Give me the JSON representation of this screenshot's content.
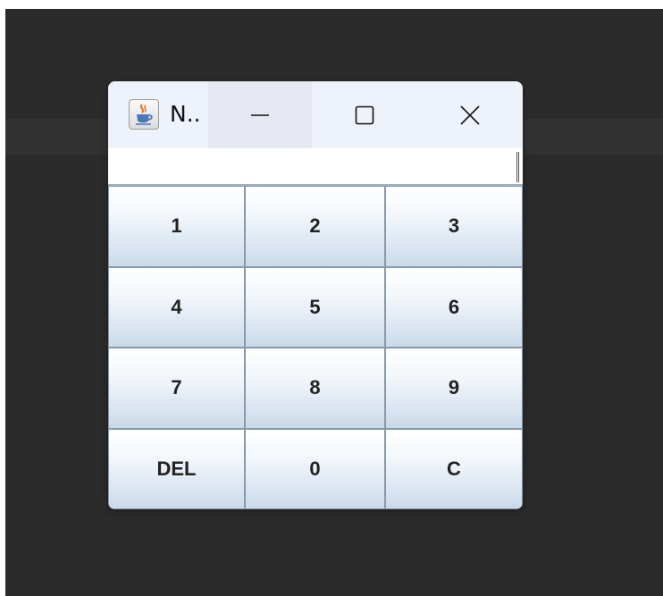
{
  "window": {
    "title": "N.."
  },
  "title_icon": "java-coffee-icon",
  "caption_buttons": {
    "minimize_icon": "minimize-icon",
    "maximize_icon": "maximize-icon",
    "close_icon": "close-icon"
  },
  "display": {
    "value": ""
  },
  "keypad": {
    "keys": [
      "1",
      "2",
      "3",
      "4",
      "5",
      "6",
      "7",
      "8",
      "9",
      "DEL",
      "0",
      "C"
    ]
  },
  "colors": {
    "desktop": "#2b2b2b",
    "titlebar": "#eef2fb",
    "key_gradient_top": "#ffffff",
    "key_gradient_bottom": "#c9d9ea",
    "key_border": "#8899aa"
  }
}
